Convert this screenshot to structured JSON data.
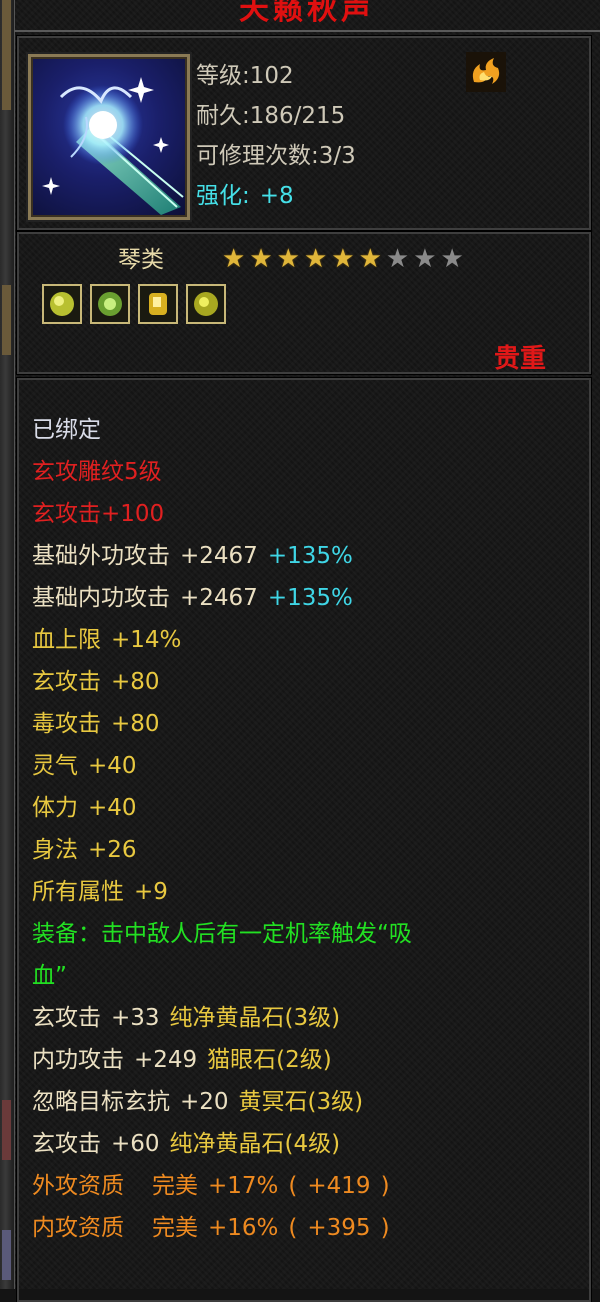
{
  "item": {
    "title": "天籁秋声",
    "level_label": "等级:102",
    "durability_label": "耐久:186/215",
    "repair_label": "可修理次数:3/3",
    "enhance_label": "强化:",
    "enhance_value": "+8",
    "category": "琴类",
    "stars_total": 9,
    "stars_filled": 6,
    "rarity": "贵重"
  },
  "attributes": {
    "bound": "已绑定",
    "engrave": "玄攻雕纹5级",
    "engrave_bonus": "玄攻击+100",
    "base_outer_label": "基础外功攻击",
    "base_outer_value": "+2467",
    "base_outer_pct": "+135%",
    "base_inner_label": "基础内功攻击",
    "base_inner_value": "+2467",
    "base_inner_pct": "+135%",
    "hp_label": "血上限",
    "hp_value": "+14%",
    "xuan_label": "玄攻击",
    "xuan_value": "+80",
    "poison_label": "毒攻击",
    "poison_value": "+80",
    "spirit_label": "灵气",
    "spirit_value": "+40",
    "stamina_label": "体力",
    "stamina_value": "+40",
    "agility_label": "身法",
    "agility_value": "+26",
    "all_label": "所有属性",
    "all_value": "+9",
    "equip_effect_line1": "装备：击中敌人后有一定机率触发“吸",
    "equip_effect_line2": "血”"
  },
  "gems": [
    {
      "stat": "玄攻击",
      "value": "+33",
      "gem": "纯净黄晶石(3级)"
    },
    {
      "stat": "内功攻击",
      "value": "+249",
      "gem": "猫眼石(2级)"
    },
    {
      "stat": "忽略目标玄抗",
      "value": "+20",
      "gem": "黄冥石(3级)"
    },
    {
      "stat": "玄攻击",
      "value": "+60",
      "gem": "纯净黄晶石(4级)"
    }
  ],
  "quality": [
    {
      "label": "外攻资质",
      "grade": "完美",
      "pct": "+17%",
      "open": "(",
      "value": "+419",
      "close": ")"
    },
    {
      "label": "内攻资质",
      "grade": "完美",
      "pct": "+16%",
      "open": "(",
      "value": "+395",
      "close": ")"
    }
  ],
  "colors": {
    "title": "#e01010",
    "bound": "#d9dce8",
    "engrave": "#e02020",
    "base": "#ebe0c2",
    "bonus": "#e8c840",
    "percent": "#3fd6e6",
    "effect": "#22e022",
    "quality": "#ee8a20",
    "rarity": "#e01818"
  },
  "icons": {
    "item_icon": "qin-instrument-icon",
    "element_icon": "fire-element-icon",
    "gem_icon": "gem-socket-icon"
  }
}
